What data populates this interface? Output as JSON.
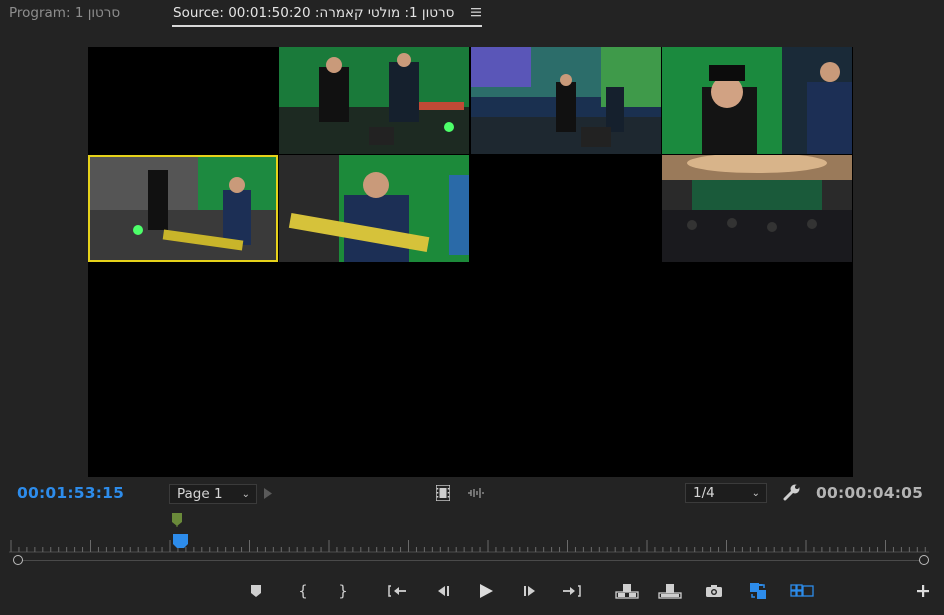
{
  "tabs": {
    "program": "Program: סרטון 1",
    "source": "Source: 00:01:50:20 :סרטון 1: מולטי קאמרה"
  },
  "viewer": {
    "angles": [
      {
        "label": "angle-1",
        "state": "empty"
      },
      {
        "label": "angle-2",
        "state": "video"
      },
      {
        "label": "angle-3",
        "state": "video"
      },
      {
        "label": "angle-4",
        "state": "video"
      },
      {
        "label": "angle-5",
        "state": "video",
        "selected": true
      },
      {
        "label": "angle-6",
        "state": "video"
      },
      {
        "label": "angle-7",
        "state": "empty"
      },
      {
        "label": "angle-8",
        "state": "video"
      }
    ]
  },
  "controls": {
    "current_timecode": "00:01:53:15",
    "duration_timecode": "00:00:04:05",
    "page_select": "Page 1",
    "zoom_select": "1/4"
  },
  "icons": {
    "panel_menu": "hamburger-menu-icon",
    "next_page": "play-right-icon",
    "film": "film-icon",
    "audio_wave": "audio-waveform-icon",
    "settings": "wrench-icon",
    "add": "plus-icon"
  },
  "transport": [
    {
      "name": "add-marker-button",
      "icon": "marker-icon"
    },
    {
      "name": "mark-in-button",
      "icon": "mark-in-icon"
    },
    {
      "name": "mark-out-button",
      "icon": "mark-out-icon"
    },
    {
      "name": "go-to-in-button",
      "icon": "go-to-in-icon"
    },
    {
      "name": "step-back-button",
      "icon": "step-back-icon"
    },
    {
      "name": "play-button",
      "icon": "play-icon"
    },
    {
      "name": "step-forward-button",
      "icon": "step-forward-icon"
    },
    {
      "name": "go-to-out-button",
      "icon": "go-to-out-icon"
    },
    {
      "name": "insert-button",
      "icon": "insert-icon"
    },
    {
      "name": "overwrite-button",
      "icon": "overwrite-icon"
    },
    {
      "name": "export-frame-button",
      "icon": "camera-icon"
    },
    {
      "name": "proxy-toggle-button",
      "icon": "proxy-icon"
    },
    {
      "name": "multicam-toggle-button",
      "icon": "multicam-icon"
    }
  ],
  "colors": {
    "accent_blue": "#2d8ceb",
    "selection_yellow": "#e6d21a",
    "panel_bg": "#232323"
  }
}
